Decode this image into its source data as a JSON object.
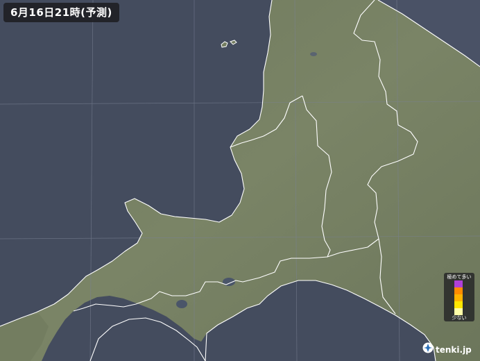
{
  "map": {
    "title": "6月16日21時(予測)",
    "legend": {
      "top_label": "極めて多い",
      "bottom_label": "少ない",
      "colors": [
        "#b040d8",
        "#ff8c00",
        "#ffb400",
        "#ffe600",
        "#ffffa8"
      ]
    },
    "logo": {
      "text": "tenki.jp",
      "icon": "tenki-logo-icon"
    },
    "colors": {
      "sea": "#444c5e",
      "land": "#757f63",
      "border": "#ffffff",
      "grid": "#7a8294"
    }
  }
}
